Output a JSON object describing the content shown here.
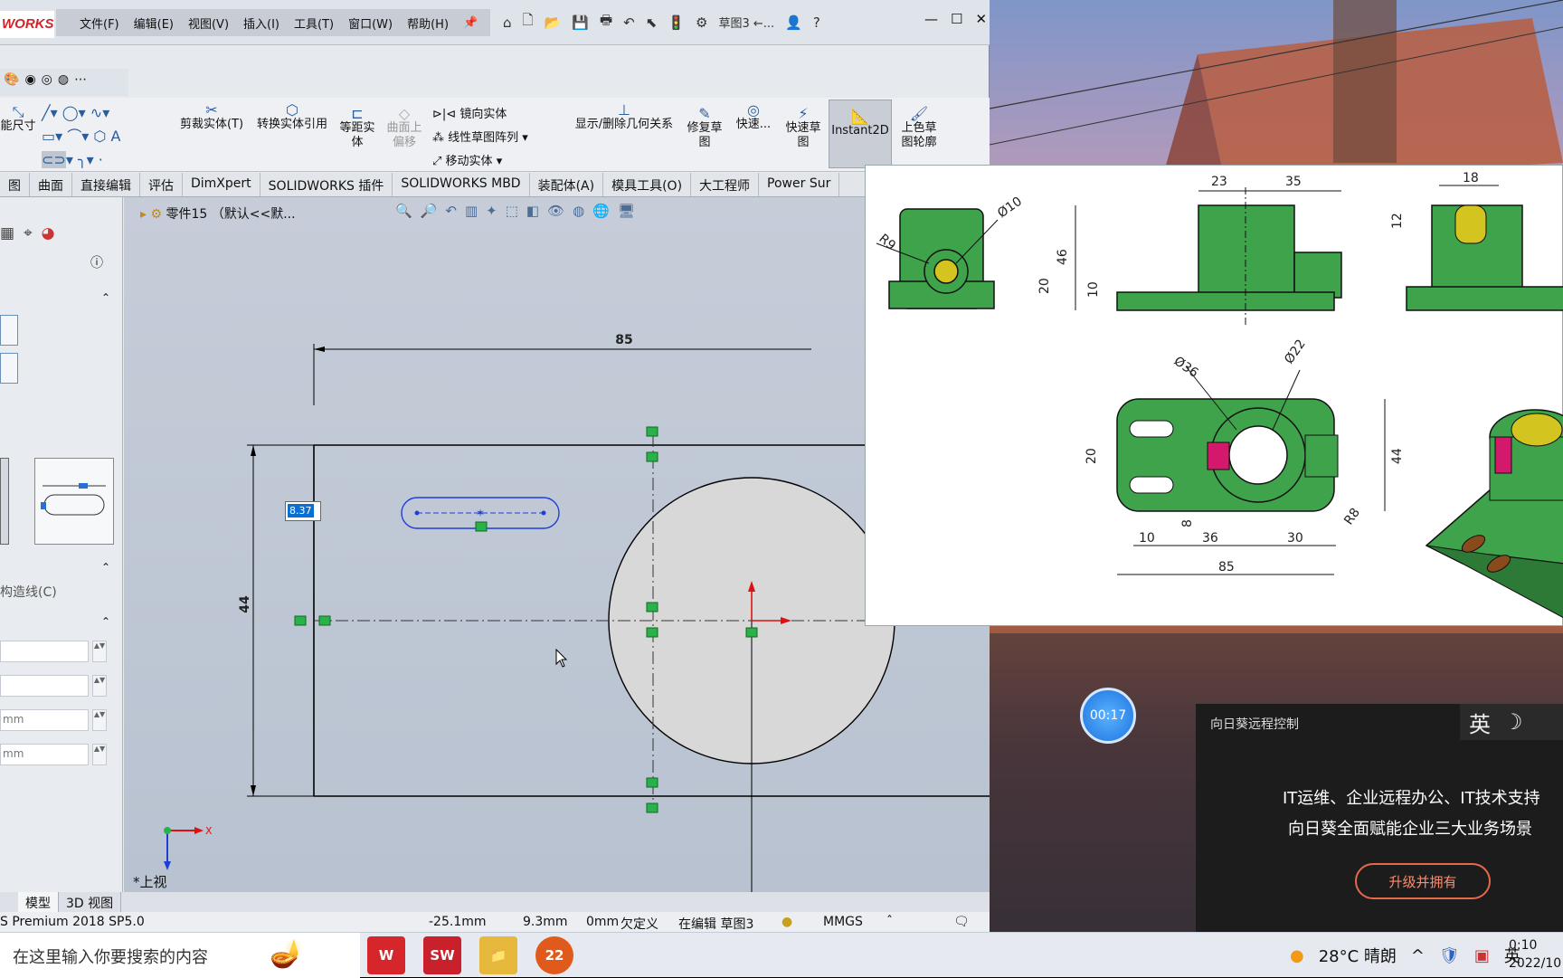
{
  "app": {
    "logo": "WORKS",
    "menu": [
      "文件(F)",
      "编辑(E)",
      "视图(V)",
      "插入(I)",
      "工具(T)",
      "窗口(W)",
      "帮助(H)"
    ],
    "document_title": "草图3 ←...",
    "help_symbol": "?"
  },
  "ribbon": {
    "smart_dim": "能尺寸",
    "trim": "剪裁实体(T)",
    "convert": "转换实体引用",
    "offset": [
      "等距实",
      "体"
    ],
    "offset_surface": [
      "曲面上",
      "偏移"
    ],
    "mirror": "镜向实体",
    "linear_pattern": "线性草图阵列",
    "move": "移动实体",
    "relations": "显示/删除几何关系",
    "repair": [
      "修复草",
      "图"
    ],
    "quick_snaps": "快速...",
    "rapid_sketch": [
      "快速草",
      "图"
    ],
    "instant2d": "Instant2D",
    "shaded_contours": [
      "上色草",
      "图轮廓"
    ]
  },
  "command_tabs": [
    "图",
    "曲面",
    "直接编辑",
    "评估",
    "DimXpert",
    "SOLIDWORKS 插件",
    "SOLIDWORKS MBD",
    "装配体(A)",
    "模具工具(O)",
    "大工程师",
    "Power Sur"
  ],
  "feature_tree": {
    "part_name": "零件15 （默认<<默...",
    "construction_label": "构造线(C)",
    "fields": [
      "",
      "",
      "mm",
      "mm"
    ]
  },
  "sketch": {
    "dim_width": "85",
    "dim_height": "44",
    "dim_edit_value": "8.37",
    "view_name": "*上视"
  },
  "bottom_tabs": [
    "模型",
    "3D 视图"
  ],
  "status": {
    "product": "S Premium 2018 SP5.0",
    "x": "-25.1mm",
    "y": "9.3mm",
    "z": "0mm",
    "state": "欠定义",
    "editing": "在编辑 草图3",
    "units": "MMGS"
  },
  "drawing": {
    "dims": [
      "23",
      "35",
      "18",
      "R9",
      "Ø10",
      "46",
      "10",
      "20",
      "12",
      "Ø36",
      "Ø22",
      "20",
      "44",
      "8",
      "R8",
      "10",
      "36",
      "30",
      "85"
    ]
  },
  "timer": "00:17",
  "sunflower": {
    "title": "向日葵远程控制",
    "ime": [
      "英",
      "☽"
    ],
    "line1": "IT运维、企业远程办公、IT技术支持",
    "line2": "向日葵全面赋能企业三大业务场景",
    "button": "升级并拥有"
  },
  "taskbar": {
    "search_placeholder": "在这里输入你要搜索的内容",
    "apps": [
      {
        "name": "wps",
        "label": "W",
        "color": "#d6262b"
      },
      {
        "name": "solidworks",
        "label": "SW",
        "color": "#c8212b"
      },
      {
        "name": "file-explorer",
        "label": "📁",
        "color": "#e6b83c"
      },
      {
        "name": "app-22",
        "label": "22",
        "color": "#e05a1c"
      }
    ],
    "weather": "28°C  晴朗",
    "ime": "英",
    "time": "0:10",
    "date": "2022/10"
  }
}
